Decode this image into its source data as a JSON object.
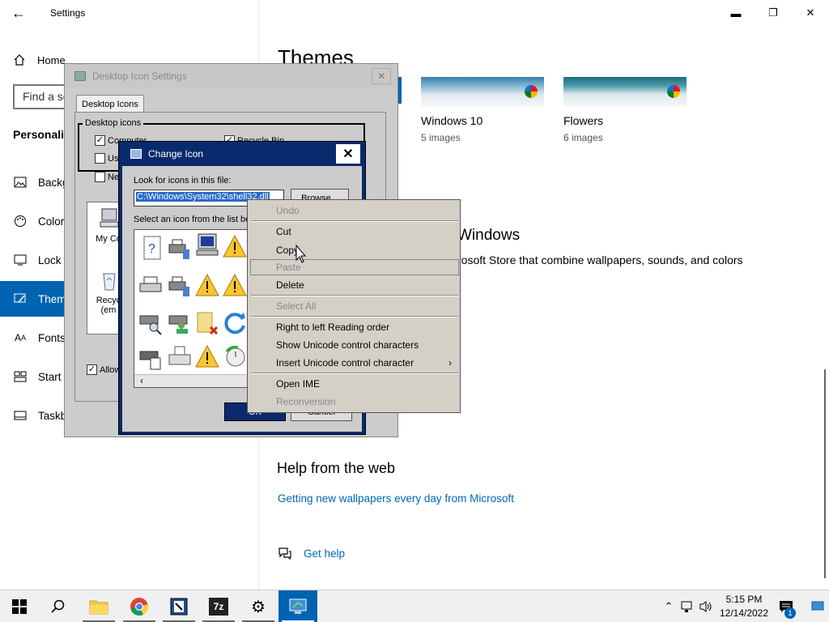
{
  "settings": {
    "title": "Settings",
    "home_label": "Home",
    "search_placeholder": "Find a se",
    "section_heading": "Personaliz",
    "nav_items": [
      {
        "label": "Backg",
        "icon": "picture-icon"
      },
      {
        "label": "Color",
        "icon": "palette-icon"
      },
      {
        "label": "Lock",
        "icon": "lock-screen-icon"
      },
      {
        "label": "Them",
        "icon": "themes-icon"
      },
      {
        "label": "Fonts",
        "icon": "fonts-icon"
      },
      {
        "label": "Start",
        "icon": "start-icon"
      },
      {
        "label": "Taskb",
        "icon": "taskbar-icon"
      }
    ],
    "selected_nav": "Them"
  },
  "main": {
    "heading": "Themes",
    "themes": [
      {
        "name": "Windows 10",
        "count": "5 images"
      },
      {
        "name": "Flowers",
        "count": "6 images"
      }
    ],
    "store_heading": "Windows",
    "store_desc": "rosoft Store that combine wallpapers, sounds, and colors",
    "help_heading": "Help from the web",
    "web_link": "Getting new wallpapers every day from Microsoft",
    "get_help": "Get help"
  },
  "desktop_icon_settings": {
    "title": "Desktop Icon Settings",
    "tab": "Desktop Icons",
    "group_label": "Desktop icons",
    "checkboxes": [
      {
        "label": "Computer",
        "checked": true
      },
      {
        "label": "Recycle Bin",
        "checked": true
      },
      {
        "label": "Use",
        "checked": false
      },
      {
        "label": "Ne",
        "checked": false
      }
    ],
    "icons": [
      {
        "label": "My Co"
      },
      {
        "label": "Recyc (em"
      }
    ],
    "allow_label": "Allow"
  },
  "change_icon": {
    "title": "Change Icon",
    "look_label": "Look for icons in this file:",
    "path_value": "C:\\Windows\\System32\\shell32.dll",
    "browse_label": "Browse...",
    "select_label": "Select an icon from the list be",
    "ok_label": "OK",
    "cancel_label": "Cancel"
  },
  "context_menu": {
    "items": [
      {
        "label": "Undo",
        "enabled": false
      },
      {
        "label": "Cut",
        "enabled": true
      },
      {
        "label": "Copy",
        "enabled": true
      },
      {
        "label": "Paste",
        "enabled": false
      },
      {
        "label": "Delete",
        "enabled": true
      },
      {
        "label": "Select All",
        "enabled": false
      },
      {
        "label": "Right to left Reading order",
        "enabled": true
      },
      {
        "label": "Show Unicode control characters",
        "enabled": true
      },
      {
        "label": "Insert Unicode control character",
        "enabled": true
      },
      {
        "label": "Open IME",
        "enabled": true
      },
      {
        "label": "Reconversion",
        "enabled": false
      }
    ]
  },
  "taskbar": {
    "apps": [
      "start-icon",
      "search-icon",
      "file-explorer-icon",
      "chrome-icon",
      "app-icon",
      "7zip-icon",
      "settings-gear-icon",
      "display-settings-icon"
    ],
    "seven_zip_label": "7z",
    "time": "5:15 PM",
    "date": "12/14/2022",
    "notification_count": "1",
    "accent": "#0063b1"
  }
}
